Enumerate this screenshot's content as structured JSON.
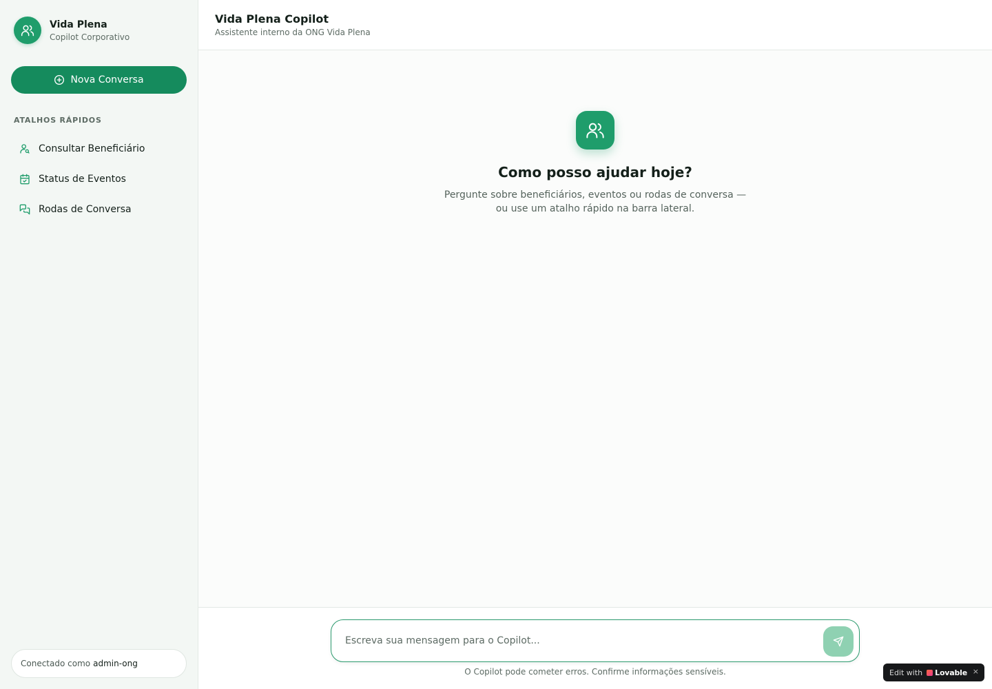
{
  "sidebar": {
    "brand": {
      "name": "Vida Plena",
      "subtitle": "Copilot Corporativo",
      "icon": "users-icon"
    },
    "new_chat": {
      "label": "Nova Conversa",
      "icon": "plus-circle-icon"
    },
    "section_label": "ATALHOS RÁPIDOS",
    "shortcuts": [
      {
        "label": "Consultar Beneficiário",
        "icon": "user-search-icon"
      },
      {
        "label": "Status de Eventos",
        "icon": "calendar-check-icon"
      },
      {
        "label": "Rodas de Conversa",
        "icon": "messages-icon"
      }
    ],
    "connection": {
      "prefix": "Conectado como",
      "user": "admin-ong"
    }
  },
  "header": {
    "title": "Vida Plena Copilot",
    "subtitle": "Assistente interno da ONG Vida Plena"
  },
  "empty_state": {
    "icon": "users-icon",
    "title": "Como posso ajudar hoje?",
    "description": "Pergunte sobre beneficiários, eventos ou rodas de conversa — ou use um atalho rápido na barra lateral."
  },
  "composer": {
    "placeholder": "Escreva sua mensagem para o Copilot...",
    "value": "",
    "send_icon": "send-icon",
    "disclaimer": "O Copilot pode cometer erros. Confirme informações sensíveis."
  },
  "badge": {
    "prefix": "Edit with",
    "brand": "Lovable",
    "close": "×"
  },
  "colors": {
    "accent": "#158b5d",
    "accent_light": "#1f9d6b",
    "send_disabled": "#8fd1b2"
  }
}
